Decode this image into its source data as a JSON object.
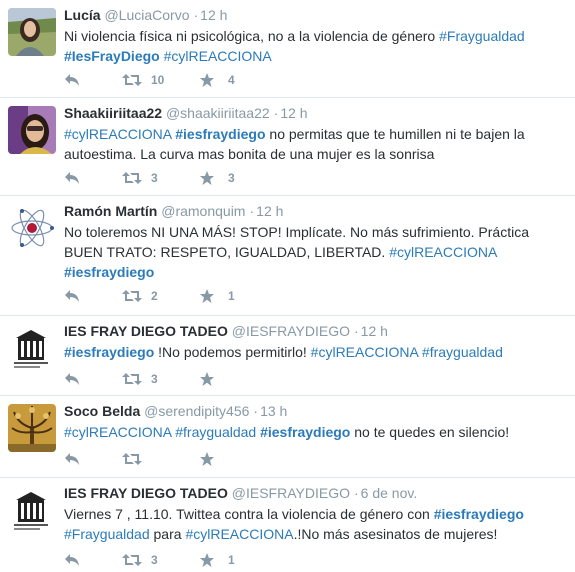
{
  "tweets": [
    {
      "fullname": "Lucía",
      "username": "@LuciaCorvo",
      "time": "12 h",
      "text": [
        {
          "t": "Ni violencia física ni psicológica, no a la violencia de género "
        },
        {
          "t": "#Fraygualdad",
          "link": true
        },
        {
          "br": true
        },
        {
          "t": "#IesFrayDiego",
          "link": true,
          "bold": true
        },
        {
          "t": " "
        },
        {
          "t": "#cylREACCIONA",
          "link": true
        }
      ],
      "retweets": "10",
      "favorites": "4"
    },
    {
      "fullname": "Shaakiiriitaa22",
      "username": "@shaakiiriitaa22",
      "time": "12 h",
      "text": [
        {
          "t": "#cylREACCIONA",
          "link": true
        },
        {
          "t": " "
        },
        {
          "t": "#iesfraydiego",
          "link": true,
          "bold": true
        },
        {
          "t": " no permitas que te humillen ni te bajen la"
        },
        {
          "br": true
        },
        {
          "t": "autoestima. La curva mas bonita de una mujer es la sonrisa"
        }
      ],
      "retweets": "3",
      "favorites": "3"
    },
    {
      "fullname": "Ramón Martín",
      "username": "@ramonquim",
      "time": "12 h",
      "text": [
        {
          "t": "No toleremos NI UNA MÁS! STOP! Implícate. No más sufrimiento. Práctica"
        },
        {
          "br": true
        },
        {
          "t": "BUEN TRATO: RESPETO, IGUALDAD, LIBERTAD. "
        },
        {
          "t": "#cylREACCIONA",
          "link": true
        },
        {
          "br": true
        },
        {
          "t": "#iesfraydiego",
          "link": true,
          "bold": true
        }
      ],
      "retweets": "2",
      "favorites": "1"
    },
    {
      "fullname": "IES FRAY DIEGO TADEO",
      "username": "@IESFRAYDIEGO",
      "time": "12 h",
      "text": [
        {
          "t": "#iesfraydiego",
          "link": true,
          "bold": true
        },
        {
          "t": " !No podemos permitirlo! "
        },
        {
          "t": "#cylREACCIONA",
          "link": true
        },
        {
          "t": "  "
        },
        {
          "t": "#fraygualdad",
          "link": true
        }
      ],
      "retweets": "3",
      "favorites": ""
    },
    {
      "fullname": "Soco Belda",
      "username": "@serendipity456",
      "time": "13 h",
      "text": [
        {
          "t": "#cylREACCIONA",
          "link": true
        },
        {
          "t": " "
        },
        {
          "t": "#fraygualdad",
          "link": true
        },
        {
          "t": " "
        },
        {
          "t": "#iesfraydiego",
          "link": true,
          "bold": true
        },
        {
          "t": " no te quedes en silencio!"
        }
      ],
      "retweets": "",
      "favorites": ""
    },
    {
      "fullname": "IES FRAY DIEGO TADEO",
      "username": "@IESFRAYDIEGO",
      "time": "6 de nov.",
      "text": [
        {
          "t": "Viernes 7 ,   11.10. Twittea contra la violencia de género con "
        },
        {
          "t": "#iesfraydiego",
          "link": true,
          "bold": true
        },
        {
          "br": true
        },
        {
          "t": "#Fraygualdad",
          "link": true
        },
        {
          "t": " para "
        },
        {
          "t": "#cylREACCIONA",
          "link": true
        },
        {
          "t": ".!No más asesinatos de mujeres!"
        }
      ],
      "retweets": "3",
      "favorites": "1"
    }
  ],
  "icons": {
    "reply": "reply-icon",
    "retweet": "retweet-icon",
    "favorite": "star-icon"
  },
  "colors": {
    "link": "#2b7bb9",
    "muted": "#8899a6",
    "text": "#292f33",
    "divider": "#e1e8ed"
  }
}
